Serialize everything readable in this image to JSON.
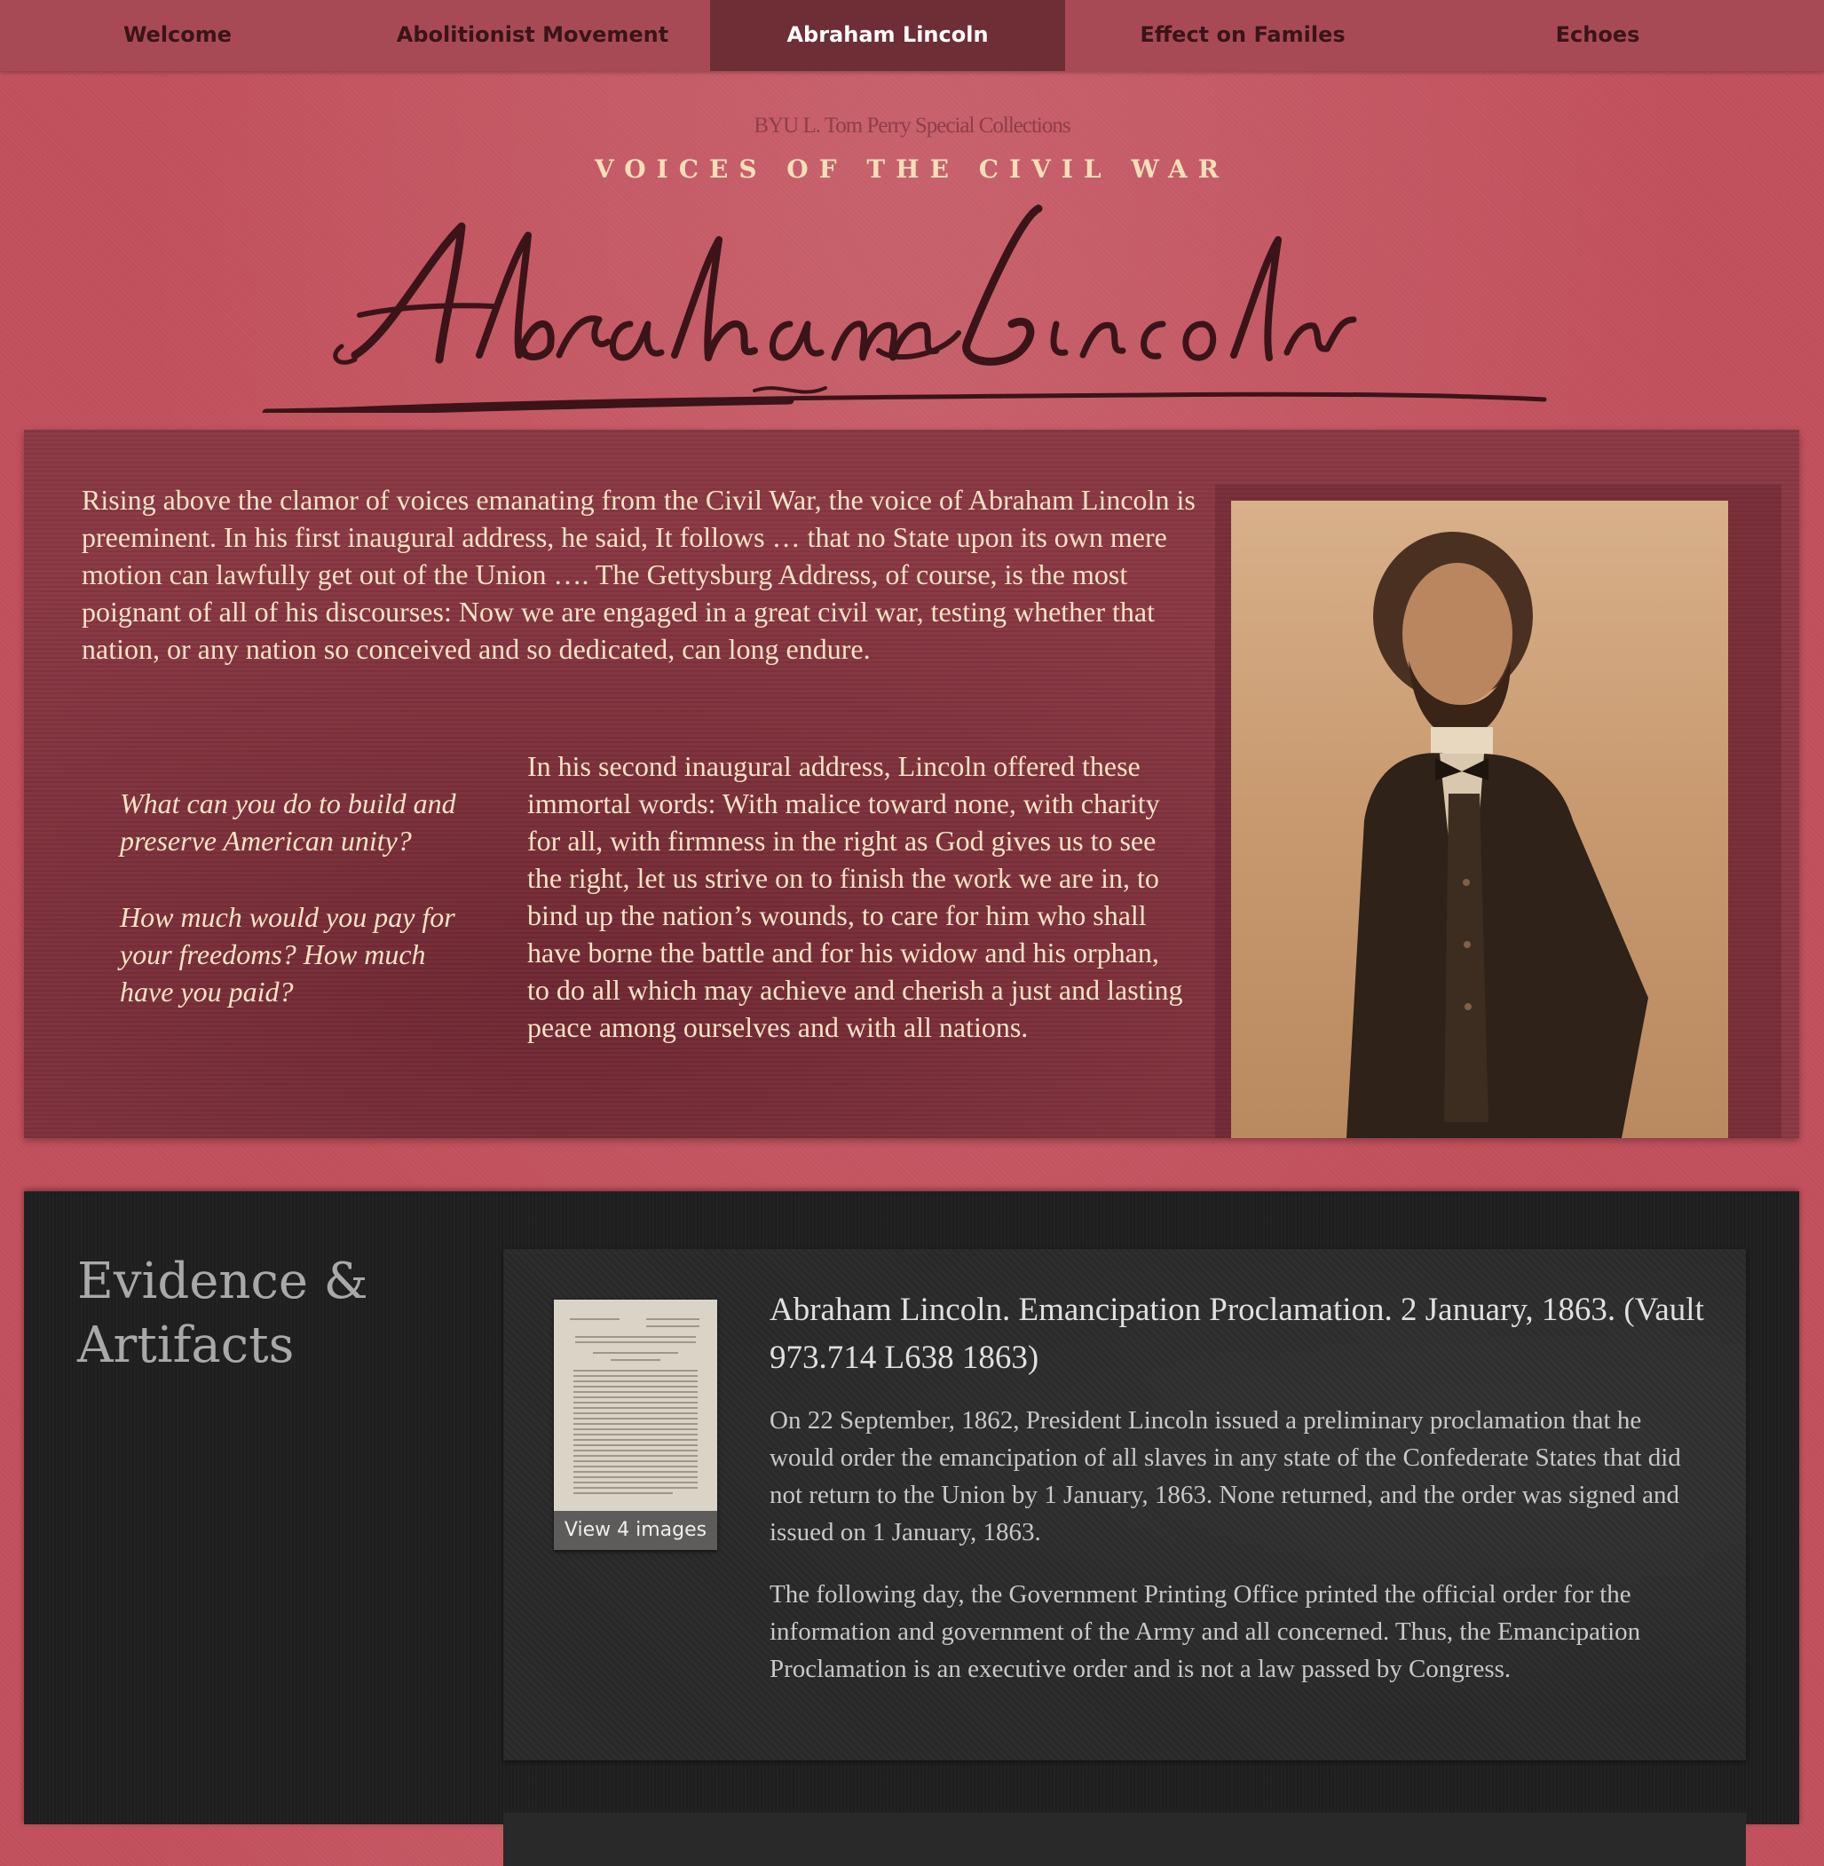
{
  "nav": {
    "items": [
      {
        "label": "Welcome"
      },
      {
        "label": "Abolitionist Movement"
      },
      {
        "label": "Abraham Lincoln"
      },
      {
        "label": "Effect on Familes"
      },
      {
        "label": "Echoes"
      }
    ],
    "active_index": 2
  },
  "header": {
    "byline": "BYU L. Tom Perry Special Collections",
    "series_title": "VOICES OF THE CIVIL WAR",
    "signature_text": "Abraham Lincoln"
  },
  "intro": {
    "lead": "Rising above the clamor of voices emanating from the Civil War, the voice of Abraham Lincoln is preeminent. In his first inaugural address, he said, It follows … that no State upon its own mere motion can lawfully get out of the Union …. The Gettysburg Address, of course, is the most poignant of all of his discourses: Now we are engaged in a great civil war, testing whether that nation, or any nation so conceived and so dedicated, can long endure.",
    "questions": [
      "What can you do to build and preserve American unity?",
      "How much would you pay for your freedoms? How much have you paid?"
    ],
    "second": "In his second inaugural address, Lincoln offered these immortal words: With malice toward none, with charity for all, with firmness in the right as God gives us to see the right, let us strive on to finish the work we are in, to bind up the nation’s wounds, to care for him who shall have borne the battle and for his widow and his orphan, to do all which may achieve and cherish a just and lasting peace among ourselves and with all nations."
  },
  "evidence": {
    "title": "Evidence & Artifacts",
    "artifact": {
      "heading": "Abraham Lincoln. Emancipation Proclamation. 2 January, 1863. (Vault 973.714 L638 1863)",
      "thumb_caption": "View 4 images",
      "paragraphs": [
        "On 22 September, 1862, President Lincoln issued a preliminary proclamation that he would order the emancipation of all slaves in any state of the Confederate States that did not return to the Union by 1 January, 1863. None returned, and the order was signed and issued on 1 January, 1863.",
        "The following day, the Government Printing Office printed the official order for the information and government of the Army and all concerned. Thus, the Emancipation Proclamation is an executive order and is not a law passed by Congress."
      ]
    }
  },
  "colors": {
    "page_background": "#c2505c",
    "nav_background": "#a84a55",
    "nav_active": "#6e2e36",
    "intro_panel": "#8a3843",
    "intro_text": "#f6e3c6",
    "evidence_panel": "#1f1f20"
  }
}
